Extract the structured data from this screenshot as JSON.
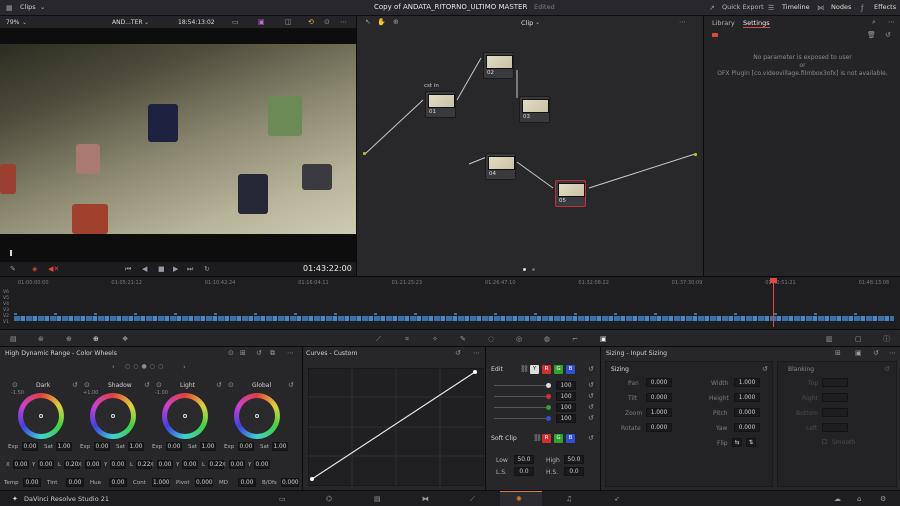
{
  "topbar": {
    "clips_label": "Clips",
    "title": "Copy of ANDATA_RITORNO_ULTIMO MASTER",
    "edited": "Edited",
    "quick_export": "Quick Export",
    "timeline": "Timeline",
    "nodes": "Nodes",
    "effects": "Effects"
  },
  "viewer": {
    "zoom": "79%",
    "clip_name": "AND...TER",
    "timecode": "18:54:13:02",
    "playhead_tc": "01:43:22:00"
  },
  "nodes": {
    "mode": "Clip",
    "items": [
      {
        "num": "01",
        "label": "cst in"
      },
      {
        "num": "02",
        "label": ""
      },
      {
        "num": "03",
        "label": ""
      },
      {
        "num": "04",
        "label": ""
      },
      {
        "num": "05",
        "label": ""
      }
    ]
  },
  "inspector": {
    "tab_library": "Library",
    "tab_settings": "Settings",
    "msg_line1": "No parameter is exposed to user",
    "msg_line2": "or",
    "msg_line3": "OFX Plugin [co.videovillage.filmbox3ofx] is not available."
  },
  "timeline": {
    "ticks": [
      "01:00:00:00",
      "01:05:21:12",
      "01:10:42:24",
      "01:16:04:11",
      "01:21:25:23",
      "01:26:47:10",
      "01:32:08:22",
      "01:37:30:09",
      "01:42:51:21",
      "01:48:13:08"
    ],
    "tracks": [
      "V6",
      "V5",
      "V4",
      "V3",
      "V2",
      "V1"
    ]
  },
  "wheels": {
    "title": "High Dynamic Range - Color Wheels",
    "items": [
      {
        "name": "Dark",
        "ev": "-1.50",
        "exp": "0.00",
        "sat": "1.00",
        "x": "0.00",
        "y": "0.00",
        "l": "0.20"
      },
      {
        "name": "Shadow",
        "ev": "+1.00",
        "exp": "0.00",
        "sat": "1.00",
        "x": "0.00",
        "y": "0.00",
        "l": "0.22"
      },
      {
        "name": "Light",
        "ev": "-1.00",
        "exp": "0.00",
        "sat": "1.00",
        "x": "0.00",
        "y": "0.00",
        "l": "0.22"
      },
      {
        "name": "Global",
        "ev": "",
        "exp": "0.00",
        "sat": "1.00",
        "x": "0.00",
        "y": "0.00",
        "l": ""
      }
    ],
    "bottom": [
      {
        "k": "Temp",
        "v": "0.00"
      },
      {
        "k": "Tint",
        "v": "0.00"
      },
      {
        "k": "Hue",
        "v": "0.00"
      },
      {
        "k": "Cont",
        "v": "1.000"
      },
      {
        "k": "Pivot",
        "v": "0.000"
      },
      {
        "k": "MD",
        "v": "0.00"
      },
      {
        "k": "B/Ofs",
        "v": "0.000"
      }
    ]
  },
  "curves": {
    "title": "Curves - Custom"
  },
  "edit": {
    "title": "Edit",
    "y": "Y",
    "r": "R",
    "g": "G",
    "b": "B",
    "values": [
      "100",
      "100",
      "100",
      "100"
    ],
    "softclip": "Soft Clip",
    "low_label": "Low",
    "low": "50.0",
    "high_label": "High",
    "high": "50.0",
    "ls_label": "L.S.",
    "ls": "0.0",
    "hs_label": "H.S.",
    "hs": "0.0"
  },
  "sizing": {
    "title": "Sizing - Input Sizing",
    "section": "Sizing",
    "pan_l": "Pan",
    "pan": "0.000",
    "tilt_l": "Tilt",
    "tilt": "0.000",
    "zoom_l": "Zoom",
    "zoom": "1.000",
    "rotate_l": "Rotate",
    "rotate": "0.000",
    "width_l": "Width",
    "width": "1.000",
    "height_l": "Height",
    "height": "1.000",
    "pitch_l": "Pitch",
    "pitch": "0.000",
    "yaw_l": "Yaw",
    "yaw": "0.000",
    "flip_l": "Flip",
    "blanking": "Blanking",
    "top": "Top",
    "right": "Right",
    "bottom": "Bottom",
    "left": "Left",
    "smooth": "Smooth"
  },
  "bottom": {
    "app": "DaVinci Resolve Studio 21"
  },
  "colors": {
    "accent": "#e0473e",
    "active": "#d97a2a"
  }
}
